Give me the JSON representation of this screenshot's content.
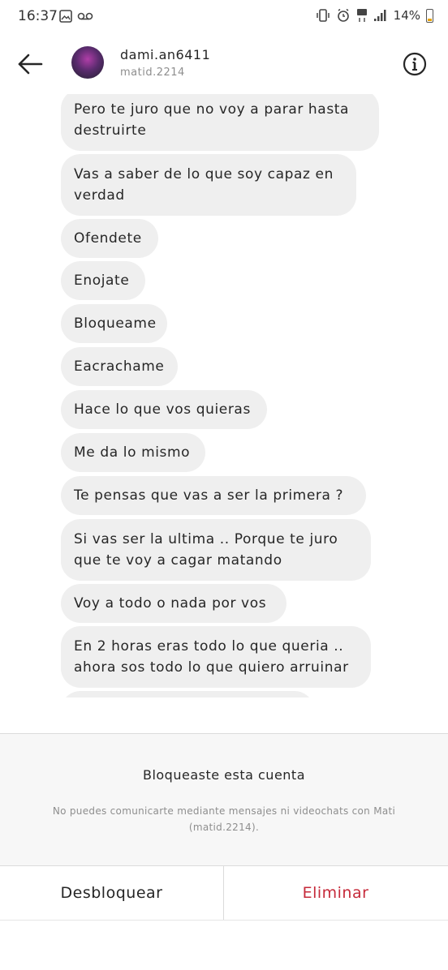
{
  "status_bar": {
    "time": "16:37",
    "battery": "14%"
  },
  "header": {
    "username": "dami.an6411",
    "handle": "matid.2214"
  },
  "messages": [
    "Pero te juro que no voy a parar hasta destruirte",
    "Vas a saber de lo que soy capaz en verdad",
    "Ofendete",
    "Enojate",
    "Bloqueame",
    "Eacrachame",
    "Hace lo que vos quieras",
    "Me da lo mismo",
    "Te pensas que vas a ser la primera ?",
    "Si vas ser la ultima .. Porque te juro que te voy a cagar matando",
    "Voy a todo o nada por vos",
    "En 2 horas eras todo lo que queria .. ahora sos todo lo que quiero arruinar"
  ],
  "blocked": {
    "title": "Bloqueaste esta cuenta",
    "description": "No puedes comunicarte mediante mensajes ni videochats con Mati (matid.2214)."
  },
  "actions": {
    "unblock": "Desbloquear",
    "delete": "Eliminar"
  },
  "colors": {
    "bubble": "#efefef",
    "delete": "#c62a3a",
    "muted": "#8e8e8e"
  }
}
